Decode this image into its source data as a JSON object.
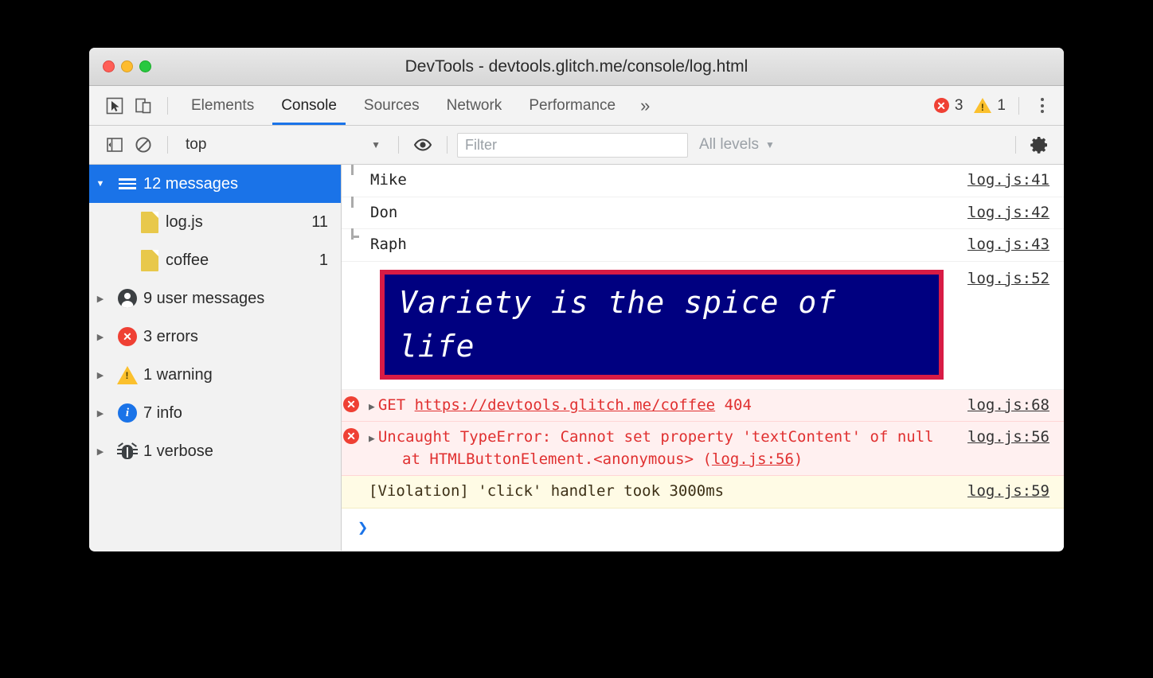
{
  "window": {
    "title": "DevTools - devtools.glitch.me/console/log.html",
    "traffic_lights": [
      "close",
      "minimize",
      "maximize"
    ]
  },
  "toolbar": {
    "inspect_icon": "cursor-select-icon",
    "device_icon": "device-toolbar-icon",
    "tabs": [
      {
        "label": "Elements",
        "active": false
      },
      {
        "label": "Console",
        "active": true
      },
      {
        "label": "Sources",
        "active": false
      },
      {
        "label": "Network",
        "active": false
      },
      {
        "label": "Performance",
        "active": false
      }
    ],
    "overflow_label": "»",
    "error_count": "3",
    "warning_count": "1",
    "more_icon": "kebab-menu-icon"
  },
  "filterbar": {
    "sidebar_toggle_icon": "show-console-sidebar-icon",
    "clear_icon": "clear-console-icon",
    "context": "top",
    "context_caret": "▼",
    "eye_icon": "live-expression-icon",
    "filter_placeholder": "Filter",
    "filter_value": "",
    "levels_label": "All levels",
    "levels_caret": "▼",
    "settings_icon": "gear-icon"
  },
  "sidebar": {
    "items": [
      {
        "label": "12 messages",
        "count": "",
        "icon": "list-icon",
        "twisty": "▼",
        "selected": true,
        "child": false
      },
      {
        "label": "log.js",
        "count": "11",
        "icon": "document-icon",
        "twisty": "",
        "selected": false,
        "child": true
      },
      {
        "label": "coffee",
        "count": "1",
        "icon": "document-icon",
        "twisty": "",
        "selected": false,
        "child": true
      },
      {
        "label": "9 user messages",
        "count": "",
        "icon": "user-icon",
        "twisty": "▶",
        "selected": false,
        "child": false
      },
      {
        "label": "3 errors",
        "count": "",
        "icon": "error-icon",
        "twisty": "▶",
        "selected": false,
        "child": false
      },
      {
        "label": "1 warning",
        "count": "",
        "icon": "warning-icon",
        "twisty": "▶",
        "selected": false,
        "child": false
      },
      {
        "label": "7 info",
        "count": "",
        "icon": "info-icon",
        "twisty": "▶",
        "selected": false,
        "child": false
      },
      {
        "label": "1 verbose",
        "count": "",
        "icon": "bug-icon",
        "twisty": "▶",
        "selected": false,
        "child": false
      }
    ]
  },
  "console": {
    "messages": [
      {
        "kind": "group-item",
        "text": "Mike",
        "source": "log.js:41"
      },
      {
        "kind": "group-item",
        "text": "Don",
        "source": "log.js:42"
      },
      {
        "kind": "group-item-last",
        "text": "Raph",
        "source": "log.js:43"
      },
      {
        "kind": "styled",
        "text": "Variety is the spice of life",
        "source": "log.js:52"
      },
      {
        "kind": "error-network",
        "method": "GET",
        "url": "https://devtools.glitch.me/coffee",
        "status": "404",
        "source": "log.js:68"
      },
      {
        "kind": "error-exception",
        "line1": "Uncaught TypeError: Cannot set property",
        "line2": "'textContent' of null",
        "stack_prefix": "at HTMLButtonElement.<anonymous> (",
        "stack_link": "log.js:56",
        "stack_suffix": ")",
        "source": "log.js:56"
      },
      {
        "kind": "violation",
        "text": "[Violation] 'click' handler took 3000ms",
        "source": "log.js:59"
      }
    ],
    "prompt_symbol": "❯",
    "banner_colors": {
      "background": "#000080",
      "border": "#d81b45",
      "text": "#ffffff"
    }
  }
}
